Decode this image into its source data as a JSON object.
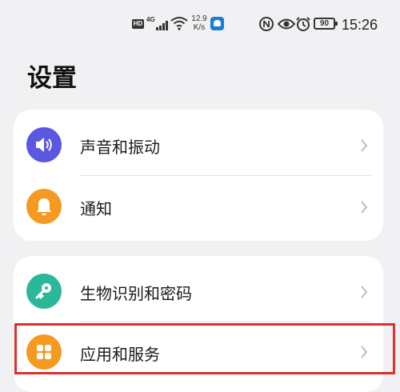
{
  "status_bar": {
    "hd": "HD",
    "network": "4G",
    "speed_value": "12.9",
    "speed_unit": "K/s",
    "battery": "90",
    "time": "15:26"
  },
  "page": {
    "title": "设置"
  },
  "groups": [
    {
      "items": [
        {
          "label": "声音和振动",
          "icon": "speaker-icon",
          "color": "#5b57e0"
        },
        {
          "label": "通知",
          "icon": "bell-icon",
          "color": "#f59a21"
        }
      ]
    },
    {
      "items": [
        {
          "label": "生物识别和密码",
          "icon": "key-icon",
          "color": "#2bb79a"
        },
        {
          "label": "应用和服务",
          "icon": "apps-grid-icon",
          "color": "#f59a21",
          "highlighted": true
        }
      ]
    }
  ],
  "colors": {
    "background": "#f1f1f3",
    "card": "#ffffff",
    "highlight_border": "#e02e2e"
  }
}
